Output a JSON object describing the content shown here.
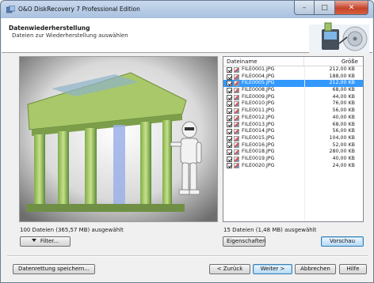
{
  "window": {
    "title": "O&O DiskRecovery 7 Professional Edition",
    "controls": {
      "minimize": "–",
      "maximize": "□",
      "close": "✕"
    }
  },
  "header": {
    "title": "Datenwiederherstellung",
    "subtitle": "Dateien zur Wiederherstellung auswählen"
  },
  "file_list": {
    "columns": {
      "name": "Dateiname",
      "size": "Größe"
    },
    "selected_index": 2,
    "rows": [
      {
        "name": "FILE0001.JPG",
        "size": "212,00 KB"
      },
      {
        "name": "FILE0004.JPG",
        "size": "188,00 KB"
      },
      {
        "name": "FILE0005.JPG",
        "size": "212,00 KB"
      },
      {
        "name": "FILE0008.JPG",
        "size": "68,00 KB"
      },
      {
        "name": "FILE0009.JPG",
        "size": "44,00 KB"
      },
      {
        "name": "FILE0010.JPG",
        "size": "76,00 KB"
      },
      {
        "name": "FILE0011.JPG",
        "size": "56,00 KB"
      },
      {
        "name": "FILE0012.JPG",
        "size": "40,00 KB"
      },
      {
        "name": "FILE0013.JPG",
        "size": "68,00 KB"
      },
      {
        "name": "FILE0014.JPG",
        "size": "56,00 KB"
      },
      {
        "name": "FILE0015.JPG",
        "size": "104,00 KB"
      },
      {
        "name": "FILE0016.JPG",
        "size": "52,00 KB"
      },
      {
        "name": "FILE0018.JPG",
        "size": "280,00 KB"
      },
      {
        "name": "FILE0019.JPG",
        "size": "40,00 KB"
      },
      {
        "name": "FILE0020.JPG",
        "size": "24,00 KB"
      }
    ]
  },
  "status": {
    "left": "100 Dateien (365,57 MB) ausgewählt",
    "right": "15 Dateien (1,48 MB) ausgewählt"
  },
  "buttons": {
    "filter": "Filter...",
    "properties": "Eigenschaften",
    "preview": "Vorschau",
    "save_recovery": "Datenrettung speichern...",
    "back": "< Zurück",
    "next": "Weiter >",
    "cancel": "Abbrechen",
    "help": "Hilfe"
  },
  "colors": {
    "selection": "#3399ff",
    "default_button_border": "#3c7fb1",
    "close_button": "#c4442a"
  }
}
